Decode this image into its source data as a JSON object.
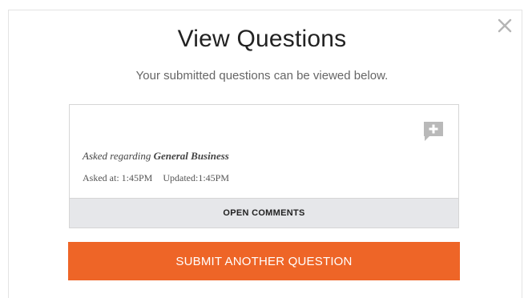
{
  "modal": {
    "title": "View Questions",
    "subtitle": "Your submitted questions can be viewed below.",
    "close_icon": "close-icon"
  },
  "question": {
    "asked_regarding_prefix": "Asked regarding",
    "topic": "General Business",
    "asked_at": "Asked at: 1:45PM",
    "updated": "Updated:1:45PM",
    "add_comment_icon": "add-comment-icon",
    "open_comments_label": "OPEN COMMENTS"
  },
  "actions": {
    "submit_label": "SUBMIT ANOTHER QUESTION"
  },
  "colors": {
    "accent": "#ee6527",
    "comments_bar": "#e6e7ea",
    "icon_gray": "#b9b9b9"
  }
}
